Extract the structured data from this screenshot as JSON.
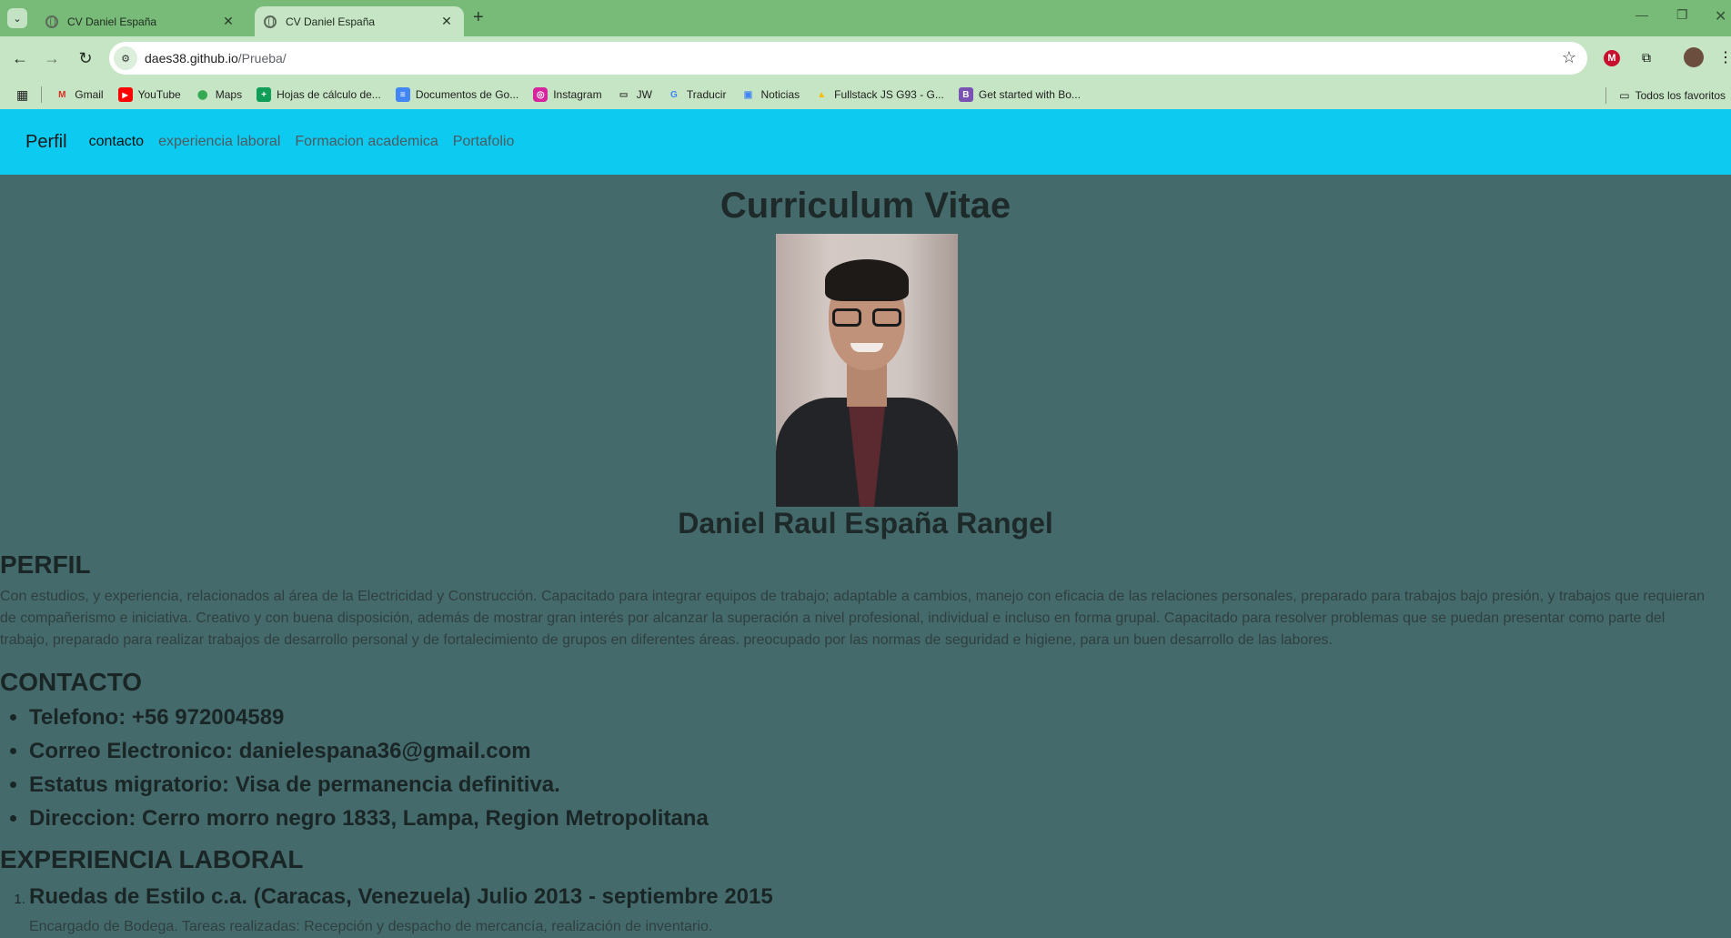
{
  "browser": {
    "tabs": [
      {
        "title": "CV Daniel España",
        "active": false
      },
      {
        "title": "CV Daniel España",
        "active": true
      }
    ],
    "url_host": "daes38.github.io",
    "url_path": "/Prueba/",
    "bookmarks": [
      {
        "label": "Gmail",
        "icon": "gmail-icon"
      },
      {
        "label": "YouTube",
        "icon": "youtube-icon"
      },
      {
        "label": "Maps",
        "icon": "maps-icon"
      },
      {
        "label": "Hojas de cálculo de...",
        "icon": "sheets-icon"
      },
      {
        "label": "Documentos de Go...",
        "icon": "docs-icon"
      },
      {
        "label": "Instagram",
        "icon": "instagram-icon"
      },
      {
        "label": "JW",
        "icon": "folder-icon"
      },
      {
        "label": "Traducir",
        "icon": "translate-icon"
      },
      {
        "label": "Noticias",
        "icon": "news-icon"
      },
      {
        "label": "Fullstack JS G93 - G...",
        "icon": "drive-icon"
      },
      {
        "label": "Get started with Bo...",
        "icon": "bootstrap-icon"
      }
    ],
    "all_bookmarks": "Todos los favoritos",
    "colors": {
      "tabbar": "#78ba78",
      "toolbar": "#c6e5c4"
    }
  },
  "navbar": {
    "brand": "Perfil",
    "links": [
      "contacto",
      "experiencia laboral",
      "Formacion academica",
      "Portafolio"
    ],
    "color": "#0dcaf0"
  },
  "page": {
    "title": "Curriculum Vitae",
    "name": "Daniel Raul España Rangel",
    "background": "#456a6b",
    "perfil": {
      "heading": "PERFIL",
      "text": "Con estudios, y experiencia, relacionados al área de la Electricidad y Construcción. Capacitado para integrar equipos de trabajo; adaptable a cambios, manejo con eficacia de las relaciones personales, preparado para trabajos bajo presión, y trabajos que requieran de compañerismo e iniciativa. Creativo y con buena disposición, además de mostrar gran interés por alcanzar la superación a nivel profesional, individual e incluso en forma grupal. Capacitado para resolver problemas que se puedan presentar como parte del trabajo, preparado para realizar trabajos de desarrollo personal y de fortalecimiento de grupos en diferentes áreas. preocupado por las normas de seguridad e higiene, para un buen desarrollo de las labores."
    },
    "contacto": {
      "heading": "CONTACTO",
      "items": [
        "Telefono: +56 972004589",
        "Correo Electronico: danielespana36@gmail.com",
        "Estatus migratorio: Visa de permanencia definitiva.",
        "Direccion: Cerro morro negro 1833, Lampa, Region Metropolitana"
      ]
    },
    "experiencia": {
      "heading": "EXPERIENCIA LABORAL",
      "jobs": [
        {
          "title": "Ruedas de Estilo c.a. (Caracas, Venezuela) Julio 2013 - septiembre 2015",
          "description": "Encargado de Bodega. Tareas realizadas: Recepción y despacho de mercancía, realización de inventario."
        }
      ]
    }
  }
}
